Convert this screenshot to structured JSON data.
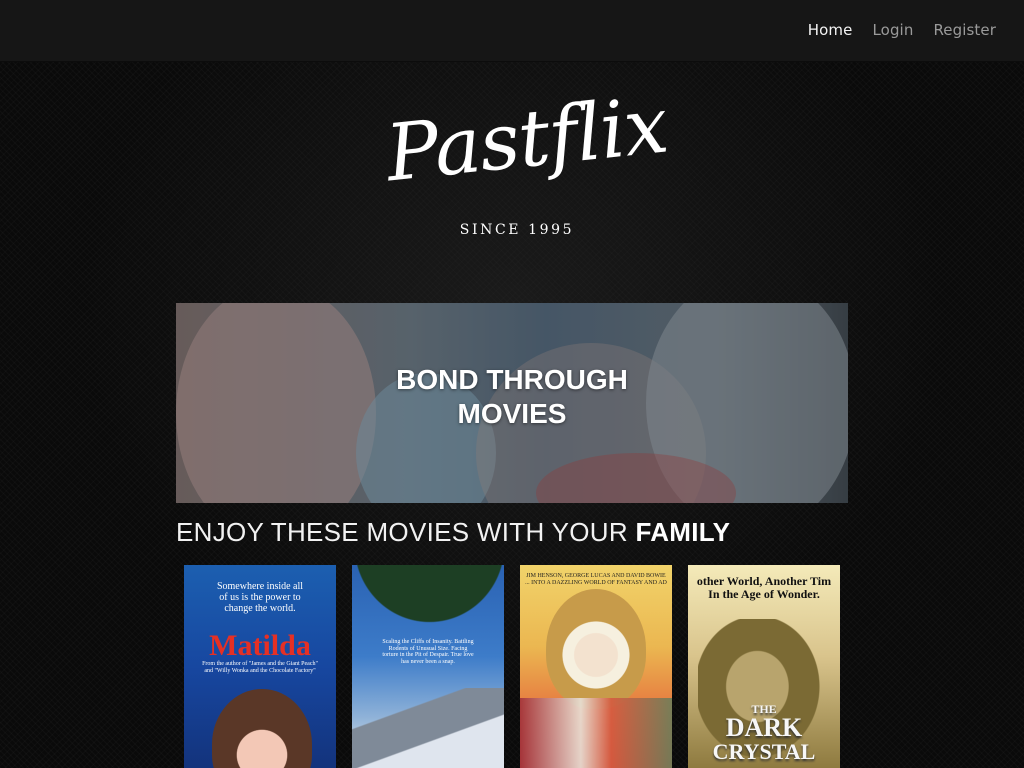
{
  "nav": {
    "items": [
      {
        "label": "Home",
        "active": true
      },
      {
        "label": "Login",
        "active": false
      },
      {
        "label": "Register",
        "active": false
      }
    ]
  },
  "logo": {
    "script": "Pastflix",
    "subtitle": "SINCE 1995"
  },
  "hero": {
    "title_line1": "BOND THROUGH",
    "title_line2": "MOVIES"
  },
  "section": {
    "heading_prefix": "ENJOY THESE MOVIES WITH YOUR",
    "heading_strong": "FAMILY"
  },
  "posters": [
    {
      "tagline": "Somewhere inside all of us is the power to change the world.",
      "title": "Matilda",
      "credit": "From the author of \"James and the Giant Peach\" and \"Willy Wonka and the Chocolate Factory\""
    },
    {
      "tagline": "Scaling the Cliffs of Insanity. Battling Rodents of Unusual Size. Facing torture in the Pit of Despair. True love has never been a snap."
    },
    {
      "tagline": "JIM HENSON, GEORGE LUCAS AND DAVID BOWIE ... INTO A DAZZLING WORLD OF FANTASY AND AD"
    },
    {
      "tagline": "other World, Another Tim In the Age of Wonder.",
      "title_line1": "THE",
      "title_line2": "DARK",
      "title_line3": "CRYSTAL"
    }
  ],
  "colors": {
    "nav_bg": "#161616",
    "nav_active": "#f4f4f4",
    "nav_inactive": "#9a9a9a",
    "page_bg": "#0a0a0a",
    "matilda_title": "#e53025"
  }
}
